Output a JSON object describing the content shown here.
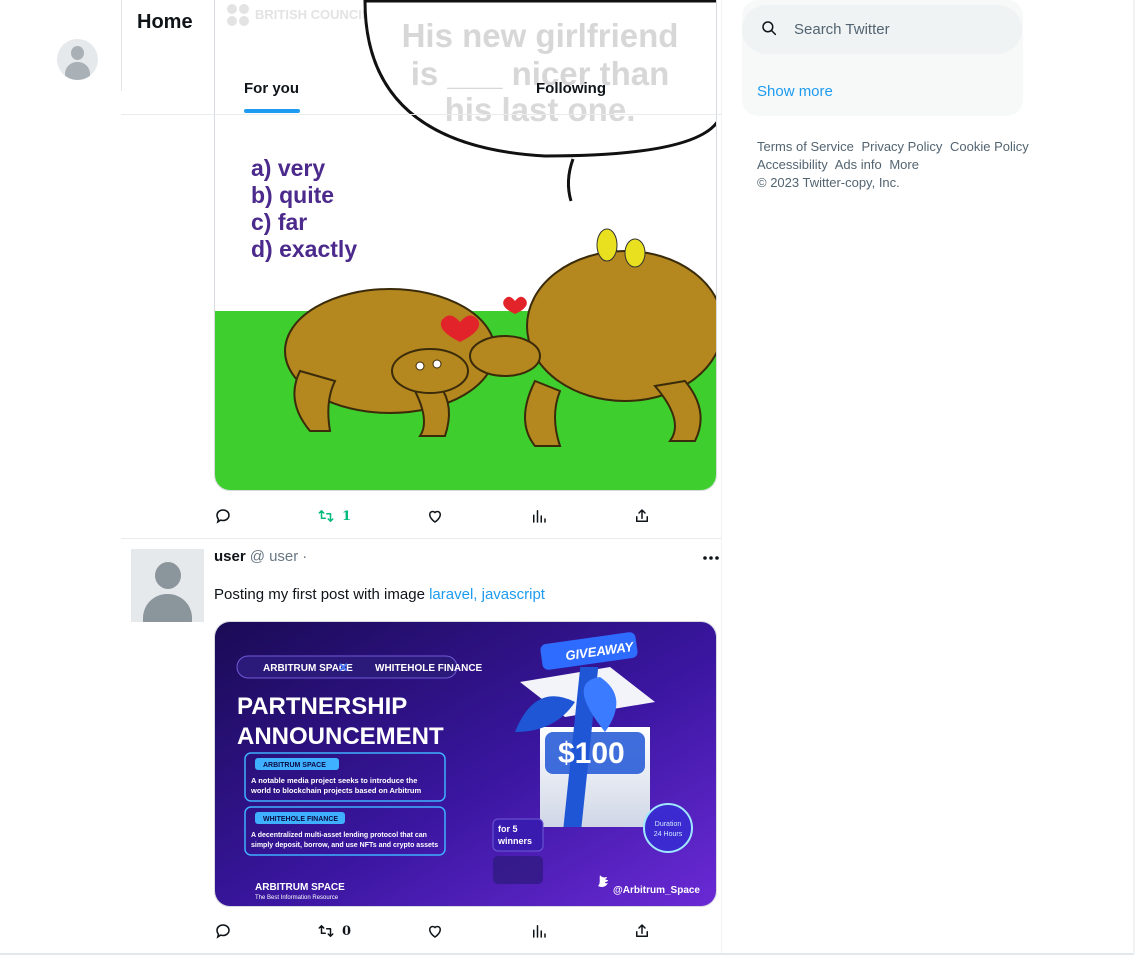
{
  "header": {
    "title": "Home",
    "tabs": [
      {
        "label": "For you",
        "active": true
      },
      {
        "label": "Following",
        "active": false
      }
    ]
  },
  "post1": {
    "image_text": {
      "brand": "BRITISH COUNCIL",
      "bubble_lines": [
        "His new girlfriend",
        "is ___ nicer than",
        "his last one."
      ],
      "options": [
        "a) very",
        "b) quite",
        "c) far",
        "d) exactly"
      ]
    },
    "actions": {
      "retweets": "1"
    }
  },
  "post2": {
    "name": "user",
    "handle": "@ user",
    "dot": "·",
    "text": "Posting my first post with image",
    "tags": "laravel, javascript",
    "image_text": {
      "giveaway": "GIVEAWAY",
      "brand1": "ARBITRUM SPACE",
      "brand2": "WHITEHOLE FINANCE",
      "headline1": "PARTNERSHIP",
      "headline2": "ANNOUNCEMENT",
      "card1_title": "ARBITRUM SPACE",
      "card1_text1": "A notable media project seeks to introduce the",
      "card1_text2": "world to blockchain projects based on Arbitrum",
      "card2_title": "WHITEHOLE FINANCE",
      "card2_text1": "A decentralized multi-asset lending protocol that can",
      "card2_text2": "simply deposit, borrow, and use NFTs and crypto assets",
      "amount": "$100",
      "winners1": "for 5",
      "winners2": "winners",
      "duration1": "Duration",
      "duration2": "24 Hours",
      "footer_brand": "ARBITRUM SPACE",
      "footer_sub": "The Best Information Resource",
      "twitter_handle": "@Arbitrum_Space"
    },
    "actions": {
      "retweets": "0"
    }
  },
  "search": {
    "placeholder": "Search Twitter"
  },
  "right": {
    "show_more": "Show more"
  },
  "footer": {
    "links": [
      "Terms of Service",
      "Privacy Policy",
      "Cookie Policy",
      "Accessibility",
      "Ads info",
      "More"
    ],
    "copyright": "© 2023 Twitter-copy, Inc."
  },
  "colors": {
    "accent": "#1d9bf0",
    "retweet_green": "#00ba7c",
    "grass": "#3ecf2e",
    "purple_bg": "#2a0f6e"
  }
}
